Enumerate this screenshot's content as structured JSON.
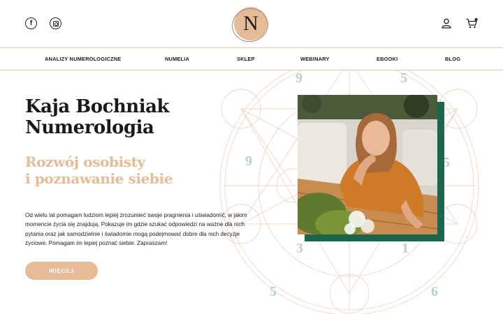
{
  "header": {
    "social": [
      {
        "icon": "facebook-icon",
        "glyph": "f"
      },
      {
        "icon": "instagram-icon"
      }
    ],
    "logo_letter": "N",
    "icons": [
      "user-icon",
      "cart-icon"
    ]
  },
  "nav": {
    "items": [
      "ANALIZY NUMEROLOGICZNE",
      "NUMELIA",
      "SKLEP",
      "WEBINARY",
      "EBOOKI",
      "BLOG"
    ]
  },
  "hero": {
    "title_line1": "Kaja Bochniak",
    "title_line2": "Numerologia",
    "subtitle_line1": "Rozwój osobisty",
    "subtitle_line2": "i poznawanie siebie",
    "description": "Od wielu lat pomagam ludziom lepiej zrozumieć swoje pragnienia i uświadomić, w jakim momencie życia się znajdują. Pokazuje im gdzie szukać odpowiedzi na ważne dla nich pytania oraz jak samodzielnie i świadomie mogą podejmować dobre dla nich decyzje życiowe. Pomagam im lepiej poznać siebie. Zapraszam!",
    "button_label": "WIĘCEJ"
  },
  "decoration": {
    "numbers": [
      "9",
      "5",
      "9",
      "5",
      "3",
      "1",
      "5",
      "6"
    ]
  },
  "colors": {
    "accent": "#e6bc98",
    "green": "#1c6650",
    "number_tint": "#b8d0c8"
  }
}
